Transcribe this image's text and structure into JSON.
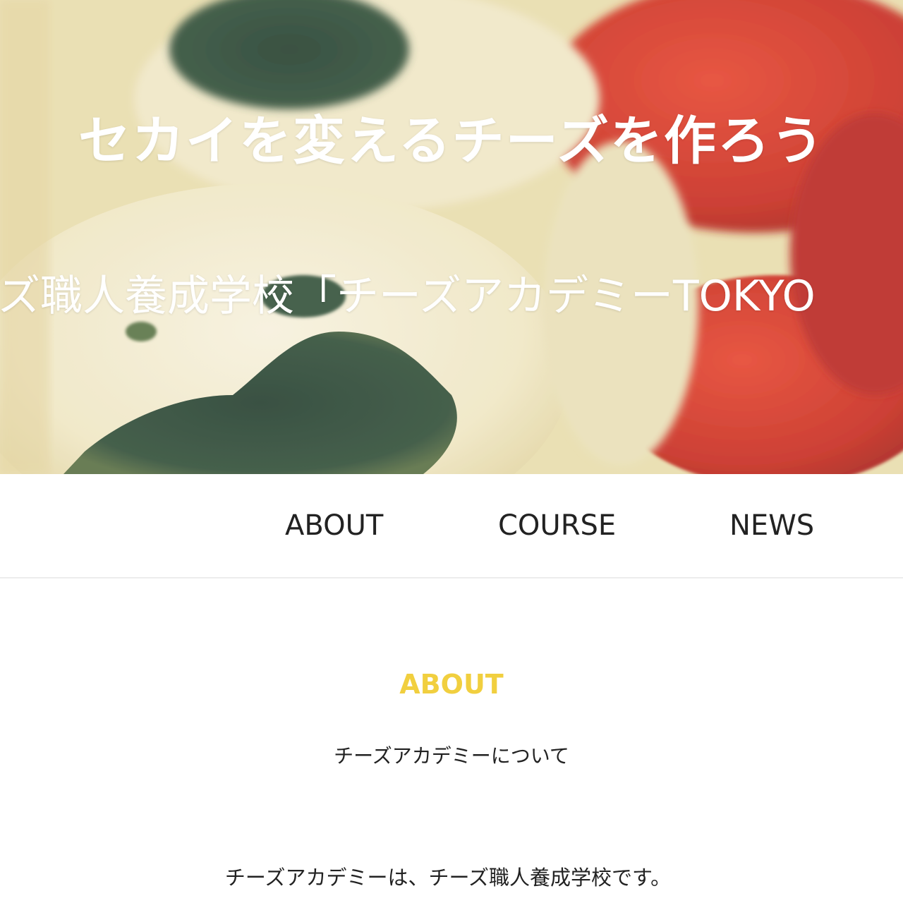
{
  "hero": {
    "title": "セカイを変えるチーズを作ろう",
    "subtitle": "ーズ職人養成学校「チーズアカデミーTOKYO",
    "image_description_icon": "cheese-tomato-photo"
  },
  "nav": {
    "items": [
      {
        "label": "ABOUT"
      },
      {
        "label": "COURSE"
      },
      {
        "label": "NEWS"
      }
    ]
  },
  "about": {
    "heading": "ABOUT",
    "subheading": "チーズアカデミーについて",
    "body": "チーズアカデミーは、チーズ職人養成学校です。"
  },
  "colors": {
    "accent": "#f1cf3f",
    "text": "#222222",
    "hero_text": "#ffffff"
  }
}
